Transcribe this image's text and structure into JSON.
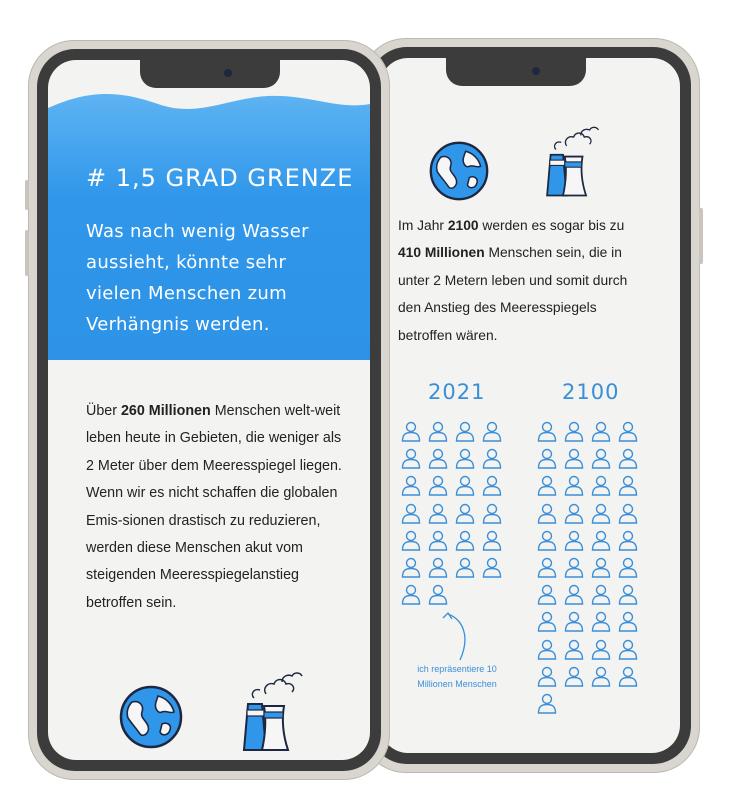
{
  "left_screen": {
    "title": "# 1,5 GRAD GRENZE",
    "subtitle": "Was nach wenig Wasser aussieht, könnte sehr vielen Menschen zum Verhängnis werden.",
    "paragraph": {
      "before": "Über ",
      "bold": "260 Millionen",
      "after": " Menschen welt-weit leben heute in Gebieten, die weniger als 2 Meter über dem Meeresspiegel liegen. Wenn wir es nicht schaffen die globalen Emis-sionen drastisch zu reduzieren, werden diese Menschen akut vom steigenden Meeresspiegelanstieg betroffen sein."
    },
    "icons": [
      "globe-icon",
      "factory-icon"
    ]
  },
  "right_screen": {
    "paragraph": {
      "p1": "Im Jahr ",
      "b1": "2100",
      "p2": " werden es sogar bis zu ",
      "b2": "410 Millionen",
      "p3": " Menschen sein, die in unter 2 Metern leben und somit durch den Anstieg des Meeresspiegels betroffen wären."
    },
    "icons": [
      "globe-icon",
      "factory-icon"
    ],
    "comparison": {
      "left": {
        "year": "2021",
        "count": 26
      },
      "right": {
        "year": "2100",
        "count": 41
      }
    },
    "note": "ich repräsentiere 10 Millionen Menschen"
  },
  "colors": {
    "accent": "#3a8fd8",
    "water": "#2f96ea",
    "frame": "#3c3c3c"
  }
}
